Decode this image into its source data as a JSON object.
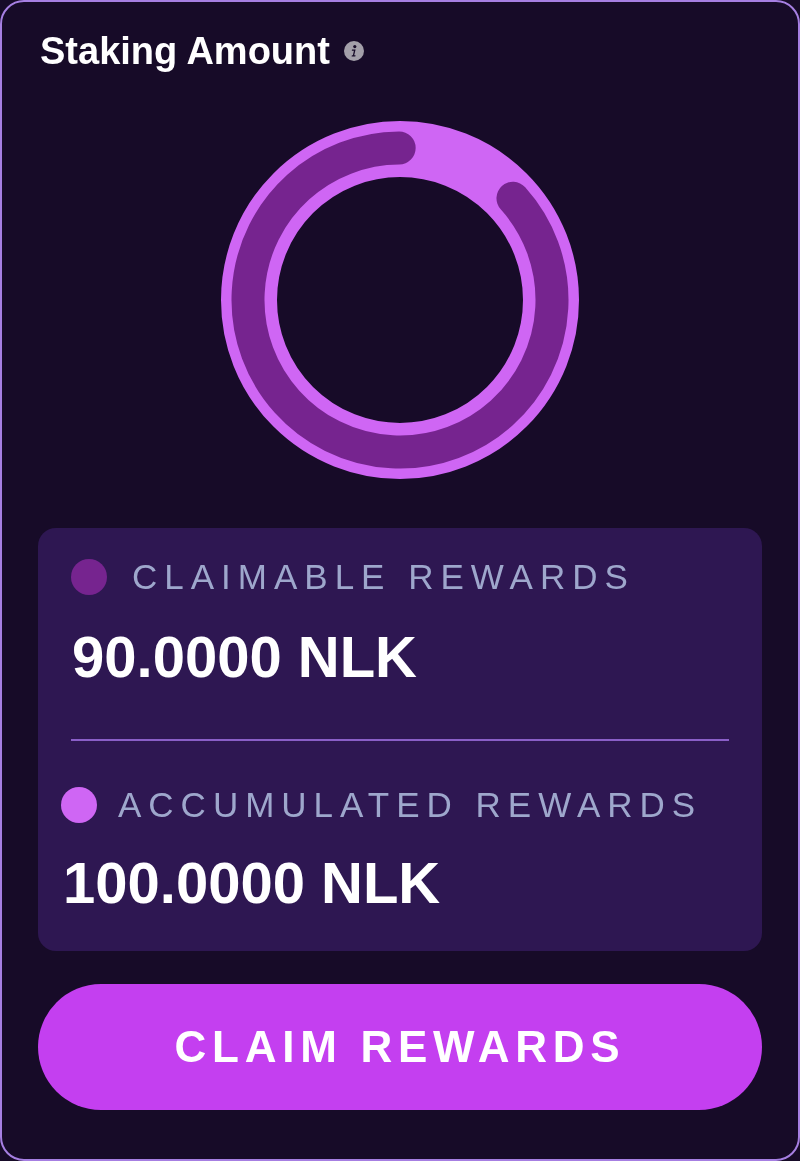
{
  "card": {
    "title": "Staking Amount"
  },
  "gauge": {
    "level": 0.9
  },
  "rewards": [
    {
      "label": "CLAIMABLE REWARDS",
      "value": "90.0000 NLK",
      "color": "#76248f"
    },
    {
      "label": "ACCUMULATED REWARDS",
      "value": "100.0000 NLK",
      "color": "#cf66f4"
    }
  ],
  "button": {
    "label": "CLAIM REWARDS"
  }
}
